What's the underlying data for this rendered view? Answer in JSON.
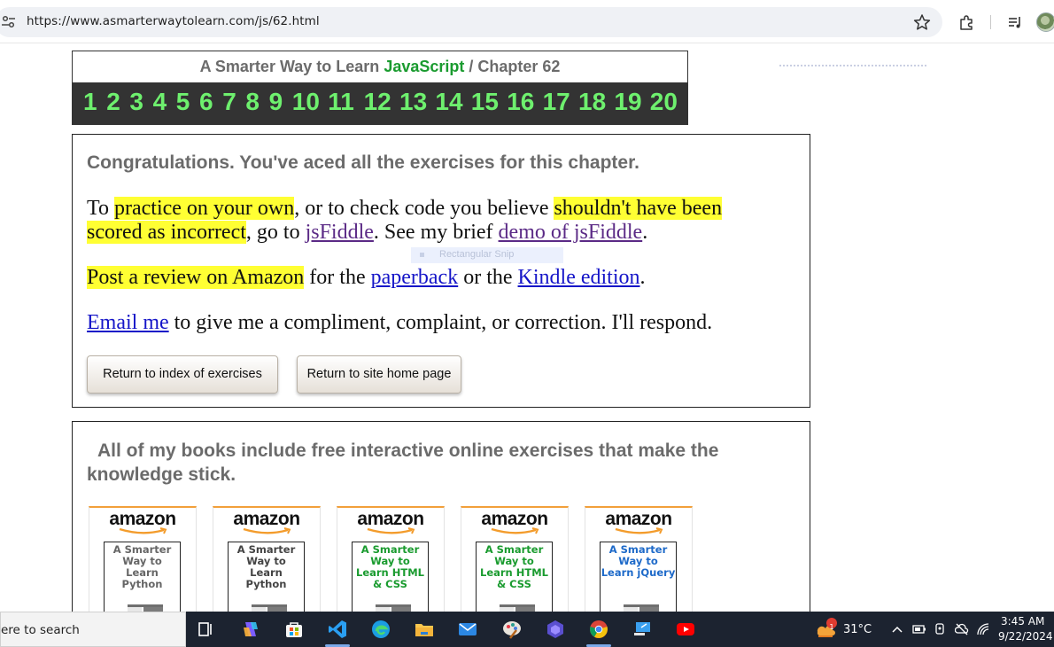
{
  "browser": {
    "url": "https://www.asmarterwaytolearn.com/js/62.html"
  },
  "header": {
    "title_prefix": "A Smarter Way to Learn ",
    "title_highlight": "JavaScript",
    "title_suffix": " / Chapter 62",
    "chapters": [
      "1",
      "2",
      "3",
      "4",
      "5",
      "6",
      "7",
      "8",
      "9",
      "10",
      "11",
      "12",
      "13",
      "14",
      "15",
      "16",
      "17",
      "18",
      "19",
      "20"
    ]
  },
  "congrats": {
    "heading": "Congratulations. You've aced all the exercises for this chapter.",
    "p1": {
      "t1": "To ",
      "hl1": "practice on your own",
      "t2": ", or to check code you believe ",
      "hl2a": "shouldn't have been",
      "hl2b": "scored as incorrect",
      "t3": ", go to ",
      "link1": "jsFiddle",
      "t4": ". See my brief ",
      "link2": "demo of jsFiddle",
      "t5": "."
    },
    "p2": {
      "hl": "Post a review on Amazon",
      "t1": " for the ",
      "link1": "paperback",
      "t2": " or the ",
      "link2": "Kindle edition",
      "t3": "."
    },
    "p3": {
      "link": "Email me",
      "t1": " to give me a compliment, complaint, or correction. I'll respond."
    },
    "buttons": {
      "index": "Return to index of exercises",
      "home": "Return to site home page"
    }
  },
  "snip_overlay": "Rectangular Snip",
  "books": {
    "heading": "All of my books include free interactive online exercises that make the knowledge stick.",
    "cards": [
      {
        "brand": "amazon",
        "title": "A Smarter Way to Learn Python",
        "color": "#666666"
      },
      {
        "brand": "amazon",
        "title": "A Smarter Way to Learn Python",
        "color": "#444444"
      },
      {
        "brand": "amazon",
        "title": "A Smarter Way to Learn HTML & CSS",
        "color": "#1a9b2f"
      },
      {
        "brand": "amazon",
        "title": "A Smarter Way to Learn HTML & CSS",
        "color": "#1a9b2f"
      },
      {
        "brand": "amazon",
        "title": "A Smarter Way to Learn jQuery",
        "color": "#1e6ac9"
      }
    ]
  },
  "taskbar": {
    "search_text": "ere to search",
    "weather": "31°C",
    "time": "3:45 AM",
    "date": "9/22/2024",
    "weather_badge": "1"
  }
}
